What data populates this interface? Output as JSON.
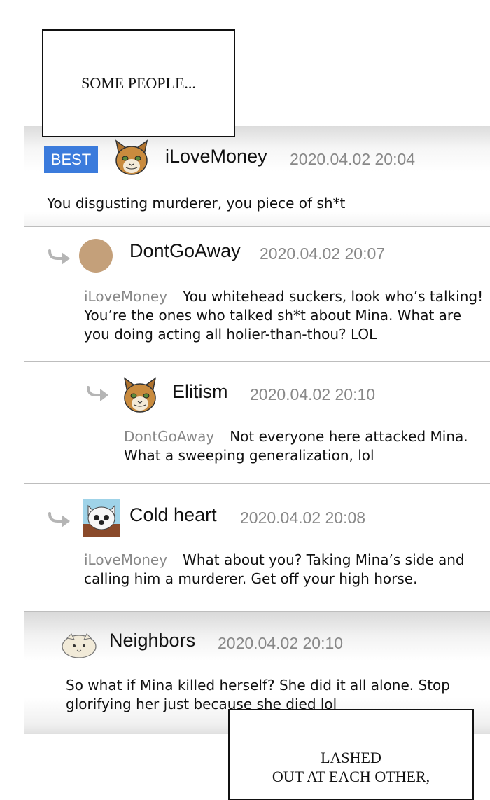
{
  "captions": {
    "top": "SOME PEOPLE...",
    "bottom_line1": "LASHED",
    "bottom_line2": "OUT AT EACH OTHER,"
  },
  "comments": [
    {
      "badge": "BEST",
      "avatar_icon": "cat-face-icon",
      "username": "iLoveMoney",
      "timestamp": "2020.04.02  20:04",
      "text": "You disgusting murderer, you piece of sh*t"
    },
    {
      "avatar_icon": "brown-circle-avatar",
      "username": "DontGoAway",
      "timestamp": "2020.04.02  20:07",
      "mention": "iLoveMoney",
      "text": "You whitehead suckers, look who’s talking! You’re the ones who talked sh*t about Mina. What are you doing acting all holier-than-thou? LOL"
    },
    {
      "avatar_icon": "cat-face-icon",
      "username": "Elitism",
      "timestamp": "2020.04.02  20:10",
      "mention": "DontGoAway",
      "text": "Not everyone here attacked Mina. What a sweeping generalization, lol"
    },
    {
      "avatar_icon": "white-cat-avatar",
      "username": "Cold heart",
      "timestamp": "2020.04.02  20:08",
      "mention": "iLoveMoney",
      "text": "What about you? Taking Mina’s side and calling him a murderer. Get off your high horse."
    },
    {
      "avatar_icon": "seal-face-avatar",
      "username": "Neighbors",
      "timestamp": "2020.04.02  20:10",
      "text": "So what if Mina killed herself? She did it all alone. Stop glorifying her just because she died lol"
    }
  ],
  "colors": {
    "best_badge": "#3b7bdc",
    "muted_text": "#888888",
    "divider": "#bdbdbd",
    "brown_avatar": "#c4a07a"
  }
}
